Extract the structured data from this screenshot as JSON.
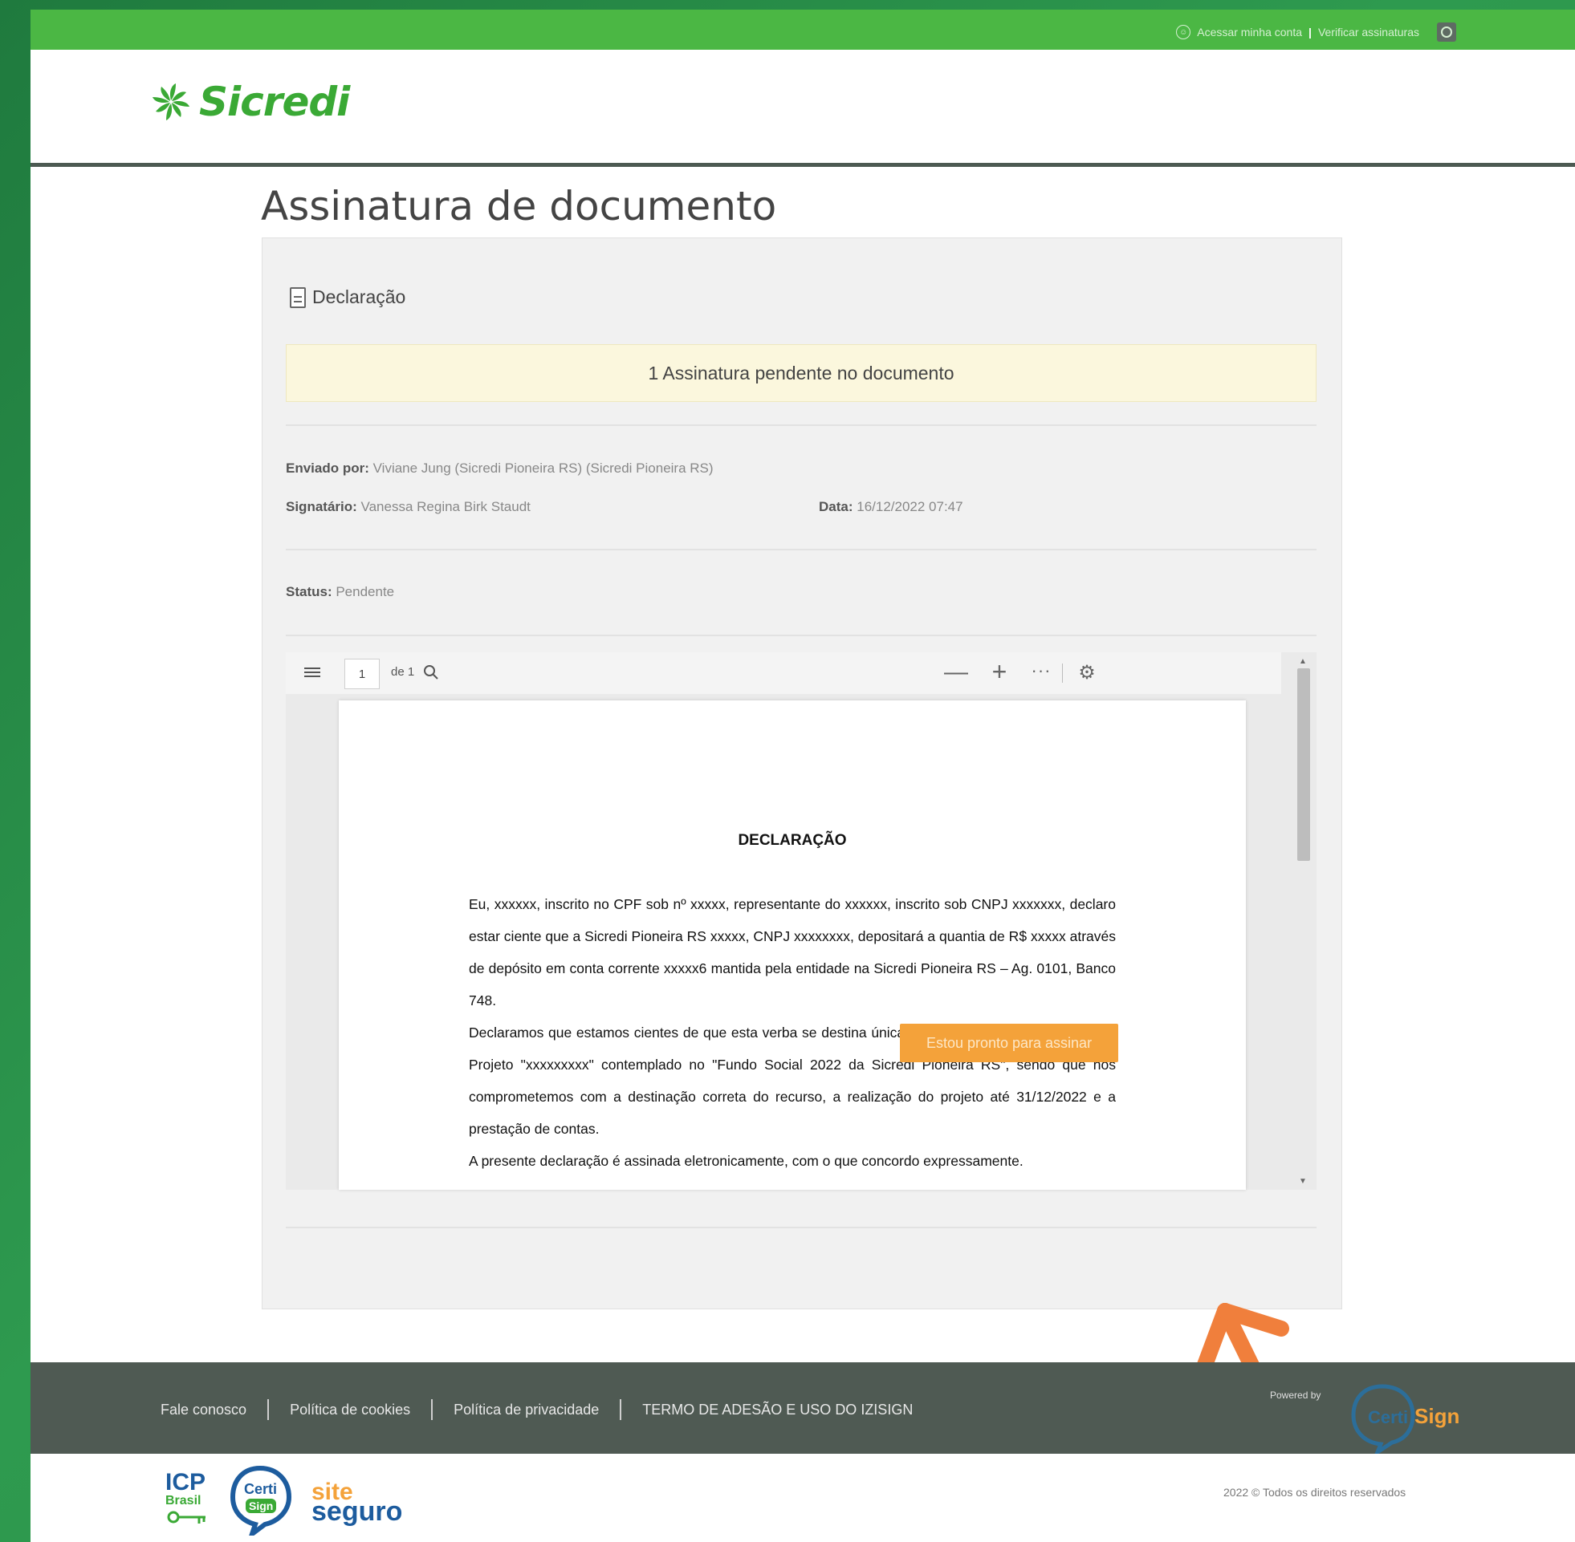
{
  "topbar": {
    "account_link": "Acessar minha conta",
    "separator": "|",
    "verify_link": "Verificar assinaturas"
  },
  "brand": {
    "logo_text": "Sicredi",
    "accent_color": "#3aa935"
  },
  "page": {
    "title": "Assinatura de documento"
  },
  "document": {
    "name": "Declaração",
    "pending_banner": "1 Assinatura pendente no documento",
    "sent_by_label": "Enviado por:",
    "sent_by_value": " Viviane Jung (Sicredi Pioneira RS) (Sicredi Pioneira RS)",
    "signer_label": "Signatário:",
    "signer_value": " Vanessa Regina Birk Staudt",
    "date_label": "Data:",
    "date_value": " 16/12/2022 07:47",
    "status_label": "Status:",
    "status_value": " Pendente"
  },
  "viewer": {
    "page_current": "1",
    "page_total": "de 1",
    "zoom_out": "—",
    "zoom_in": "+",
    "more": "···",
    "settings_icon": "⚙",
    "pdf_title": "DECLARAÇÃO",
    "paragraph_1": "Eu, xxxxxx, inscrito no CPF sob nº xxxxx, representante do xxxxxx, inscrito sob CNPJ xxxxxxx, declaro estar ciente que a Sicredi Pioneira RS xxxxx, CNPJ xxxxxxxx, depositará a quantia de R$ xxxxx através de depósito em conta corrente xxxxx6 mantida pela entidade na Sicredi Pioneira RS – Ag. 0101, Banco 748.",
    "paragraph_2": "Declaramos que estamos cientes de que esta verba se destina única e exclusivamente à execução do Projeto \"xxxxxxxxx\" contemplado no \"Fundo Social 2022 da Sicredi Pioneira RS\", sendo que nos comprometemos com a destinação correta do recurso, a realização do projeto até 31/12/2022 e a prestação de contas.",
    "paragraph_3": "A presente declaração é assinada eletronicamente, com o que concordo expressamente."
  },
  "actions": {
    "sign_button": "Estou pronto para assinar",
    "sign_button_color": "#f4a23a",
    "arrow_color": "#f07f3c"
  },
  "footer": {
    "links": [
      "Fale conosco",
      "Política de cookies",
      "Política de privacidade",
      "TERMO DE ADESÃO E USO DO IZISIGN"
    ],
    "powered_by": "Powered by",
    "certisign_logo": "CertiSign",
    "copyright": "2022 © Todos os direitos reservados",
    "badges": {
      "icp_top": "ICP",
      "icp_bottom": "Brasil",
      "certi": "Certi",
      "sign": "Sign",
      "site": "site",
      "seguro": "seguro"
    }
  }
}
